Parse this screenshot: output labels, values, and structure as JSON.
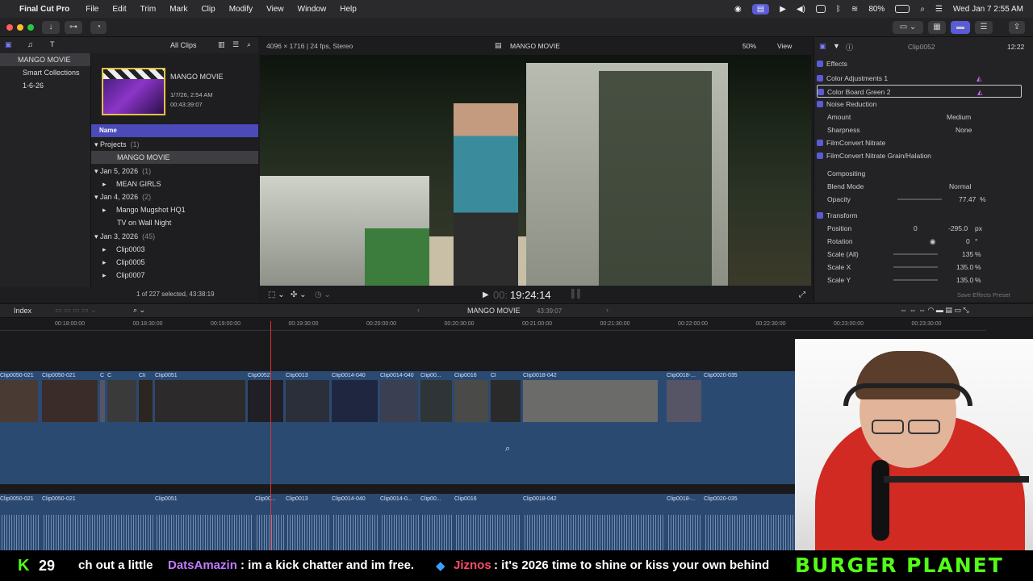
{
  "menubar": {
    "app": "Final Cut Pro",
    "items": [
      "File",
      "Edit",
      "Trim",
      "Mark",
      "Clip",
      "Modify",
      "View",
      "Window",
      "Help"
    ],
    "battery": "80%",
    "clock": "Wed Jan 7  2:55 AM"
  },
  "browser": {
    "filter": "All Clips",
    "library": "MANGO MOVIE",
    "libraries": [
      "MANGO MOVIE",
      "Smart Collections",
      "1-6-26"
    ],
    "project": {
      "title": "MANGO MOVIE",
      "date": "1/7/26, 2:54 AM",
      "duration": "00:43:39:07"
    },
    "col_name": "Name",
    "rows": [
      {
        "label": "Projects",
        "count": "(1)",
        "kind": "group"
      },
      {
        "label": "MANGO MOVIE",
        "kind": "item"
      },
      {
        "label": "Jan 5, 2026",
        "count": "(1)",
        "kind": "group"
      },
      {
        "label": "MEAN GIRLS",
        "kind": "item"
      },
      {
        "label": "Jan 4, 2026",
        "count": "(2)",
        "kind": "group"
      },
      {
        "label": "Mango Mugshot HQ1",
        "kind": "item"
      },
      {
        "label": "TV on Wall Night",
        "kind": "item"
      },
      {
        "label": "Jan 3, 2026",
        "count": "(45)",
        "kind": "group"
      },
      {
        "label": "Clip0003",
        "kind": "item"
      },
      {
        "label": "Clip0005",
        "kind": "item"
      },
      {
        "label": "Clip0007",
        "kind": "item"
      }
    ],
    "selection": "1 of 227 selected, 43:38:19"
  },
  "viewer": {
    "format": "4096 × 1716 | 24 fps, Stereo",
    "title": "MANGO MOVIE",
    "zoom": "50%",
    "view": "View",
    "timecode_dim": "00:",
    "timecode": "19:24:14"
  },
  "inspector": {
    "clip": "Clip0052",
    "duration": "12:22",
    "effects_label": "Effects",
    "effects": [
      "Color Adjustments 1",
      "Color Board Green 2",
      "Noise Reduction"
    ],
    "amount_label": "Amount",
    "amount": "Medium",
    "sharpness_label": "Sharpness",
    "sharpness": "None",
    "effects2": [
      "FilmConvert Nitrate",
      "FilmConvert Nitrate Grain/Halation"
    ],
    "compositing": "Compositing",
    "blend_label": "Blend Mode",
    "blend": "Normal",
    "opacity_label": "Opacity",
    "opacity": "77.47",
    "pct": "%",
    "transform": "Transform",
    "position_label": "Position",
    "px": "0",
    "py": "-295.0",
    "unit": "px",
    "rotation_label": "Rotation",
    "rotation": "0",
    "deg": "°",
    "scale_all_label": "Scale (All)",
    "scale_all": "135",
    "scale_x_label": "Scale X",
    "scale_x": "135.0",
    "scale_y_label": "Scale Y",
    "scale_y": "135.0",
    "save_preset": "Save Effects Preset"
  },
  "timeline": {
    "index": "Index",
    "project": "MANGO MOVIE",
    "duration": "43:39:07",
    "ticks": [
      "00:18:00:00",
      "00:18:30:00",
      "00:19:00:00",
      "00:19:30:00",
      "00:20:00:00",
      "00:20:30:00",
      "00:21:00:00",
      "00:21:30:00",
      "00:22:00:00",
      "00:22:30:00",
      "00:23:00:00",
      "00:23:30:00"
    ],
    "vclips": [
      "Clip0050-021",
      "Clip0050-021",
      "C",
      "C",
      "Cli",
      "Clip0051",
      "Clip0052",
      "Clip0013",
      "Clip0014-040",
      "Clip0014-040",
      "Clip00...",
      "Clip0016",
      "Cl",
      "Clip0018-042",
      "Clip0018-...",
      "Clip0020-035",
      "Clip001...",
      "Clip0020-0",
      "Cl"
    ],
    "aclips": [
      "Clip0050-021",
      "Clip0050-021",
      "Clip0051",
      "Clip00...",
      "Clip0013",
      "Clip0014-040",
      "Clip0014-0...",
      "Clip00...",
      "Clip0016",
      "Clip0018-042",
      "Clip0018-...",
      "Clip0020-035"
    ]
  },
  "chat": {
    "kick_count": "29",
    "msg1": "ch out a little",
    "user1": "DatsAmazin",
    "msg2": ": im a kick chatter and im free.",
    "user2": "Jiznos",
    "msg3": ": it's 2026 time to shine or kiss your own behind",
    "brand": "BURGER PLANET"
  },
  "colors": {
    "accent": "#5b5bd6",
    "track": "#2b4a72",
    "kick": "#53fc18",
    "user1": "#c07cff",
    "user2": "#ff4a6a"
  }
}
